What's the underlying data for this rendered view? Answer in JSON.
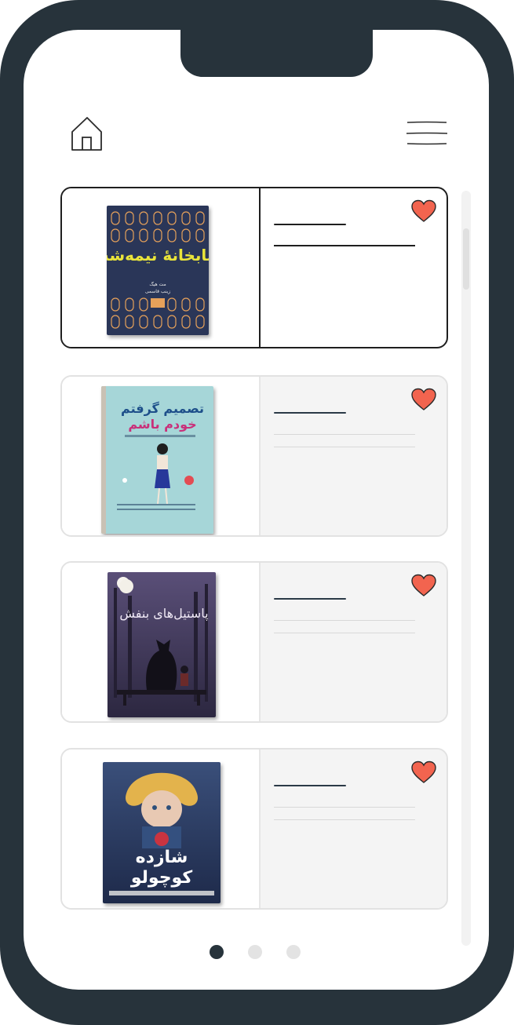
{
  "colors": {
    "frame": "#27333b",
    "heart": "#f2644f",
    "heart_outline": "#2a2a2a",
    "dot_active": "#27333b",
    "dot_inactive": "#e3e3e3"
  },
  "header": {
    "home_icon": "home-icon",
    "menu_icon": "hamburger-menu-icon"
  },
  "books": [
    {
      "id": "book-1",
      "title_cover": "کتابخانهٔ نیمه‌شب",
      "author_cover": "مت هیگ",
      "translator_cover": "زینب قاسمی",
      "favorite_icon": "heart-icon",
      "selected": true
    },
    {
      "id": "book-2",
      "title_cover_line1": "تصمیم گرفتم",
      "title_cover_line2": "خودم باشم",
      "favorite_icon": "heart-icon",
      "selected": false
    },
    {
      "id": "book-3",
      "title_cover": "پاستیل‌های بنفش",
      "favorite_icon": "heart-icon",
      "selected": false
    },
    {
      "id": "book-4",
      "title_cover_line1": "شازده",
      "title_cover_line2": "کوچولو",
      "favorite_icon": "heart-icon",
      "selected": false
    }
  ],
  "pagination": {
    "total": 3,
    "current": 1
  }
}
